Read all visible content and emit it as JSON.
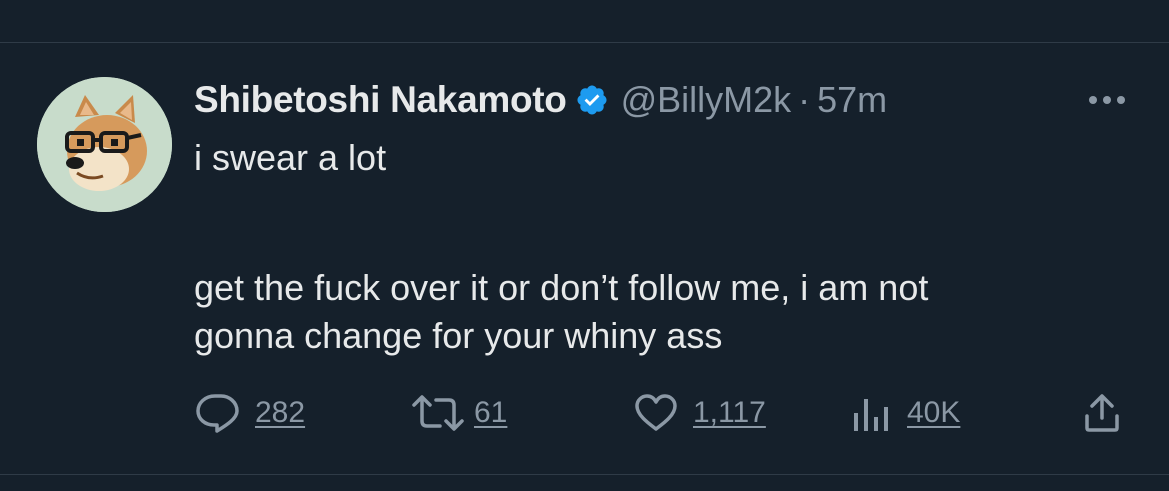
{
  "tweet": {
    "author": {
      "display_name": "Shibetoshi Nakamoto",
      "handle": "@BillyM2k",
      "verified": true,
      "avatar": "doge-with-glasses-avatar"
    },
    "separator": "·",
    "timestamp": "57m",
    "text_lines": [
      "i swear a lot",
      "get the fuck over it or don’t follow me, i am not",
      "gonna change for your whiny ass"
    ],
    "stats": {
      "replies": "282",
      "retweets": "61",
      "likes": "1,117",
      "views": "40K"
    }
  },
  "icons": {
    "verified": "verified-badge-icon",
    "more": "more-options-icon",
    "reply": "reply-icon",
    "retweet": "retweet-icon",
    "like": "heart-icon",
    "views": "views-icon",
    "share": "share-icon"
  },
  "colors": {
    "background": "#15202b",
    "text": "#e7e9ea",
    "secondary_text": "#8b98a5",
    "verified_badge": "#1d9bf0",
    "divider": "#2f3b47"
  }
}
